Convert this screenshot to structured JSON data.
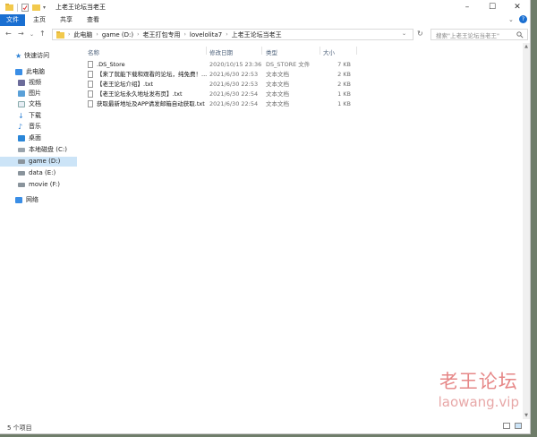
{
  "window": {
    "title": "上老王论坛当老王"
  },
  "ribbon": {
    "tabs": [
      {
        "label": "文件"
      },
      {
        "label": "主页"
      },
      {
        "label": "共享"
      },
      {
        "label": "查看"
      }
    ]
  },
  "address": {
    "crumbs": [
      "此电脑",
      "game (D:)",
      "老王打包专用",
      "lovelolita7",
      "上老王论坛当老王"
    ],
    "search_placeholder": "搜索\"上老王论坛当老王\""
  },
  "sidebar": {
    "items": [
      {
        "label": "快速访问",
        "icon": "star-icon"
      },
      {
        "label": "此电脑",
        "icon": "computer-icon"
      },
      {
        "label": "视频",
        "icon": "video-icon"
      },
      {
        "label": "图片",
        "icon": "picture-icon"
      },
      {
        "label": "文档",
        "icon": "document-icon"
      },
      {
        "label": "下载",
        "icon": "download-icon"
      },
      {
        "label": "音乐",
        "icon": "music-icon"
      },
      {
        "label": "桌面",
        "icon": "desktop-icon"
      },
      {
        "label": "本地磁盘 (C:)",
        "icon": "drive-icon"
      },
      {
        "label": "game (D:)",
        "icon": "drive-icon"
      },
      {
        "label": "data (E:)",
        "icon": "drive-icon"
      },
      {
        "label": "movie (F:)",
        "icon": "drive-icon"
      },
      {
        "label": "网络",
        "icon": "network-icon"
      }
    ]
  },
  "columns": {
    "name": "名称",
    "date": "修改日期",
    "type": "类型",
    "size": "大小"
  },
  "files": [
    {
      "name": ".DS_Store",
      "date": "2020/10/15 23:36",
      "type": "DS_STORE 文件",
      "size": "7 KB"
    },
    {
      "name": "【来了就能下载和观看的论坛，纯免费！...",
      "date": "2021/6/30 22:53",
      "type": "文本文档",
      "size": "2 KB"
    },
    {
      "name": "【老王论坛介绍】.txt",
      "date": "2021/6/30 22:53",
      "type": "文本文档",
      "size": "2 KB"
    },
    {
      "name": "【老王论坛永久地址发布页】.txt",
      "date": "2021/6/30 22:54",
      "type": "文本文档",
      "size": "1 KB"
    },
    {
      "name": "获取最新地址及APP请发邮箱自动获取.txt",
      "date": "2021/6/30 22:54",
      "type": "文本文档",
      "size": "1 KB"
    }
  ],
  "status": {
    "count": "5 个项目"
  },
  "watermark": {
    "line1": "老王论坛",
    "line2": "laowang.vip"
  },
  "colors": {
    "accent": "#1a6fd1",
    "selection": "#cce4f7"
  }
}
